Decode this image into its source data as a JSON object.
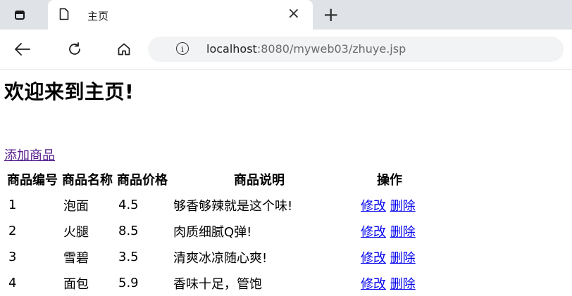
{
  "browser": {
    "tab_title": "主页",
    "close_glyph": "×",
    "new_tab_glyph": "+",
    "url_host": "localhost",
    "url_rest": ":8080/myweb03/zhuye.jsp"
  },
  "page": {
    "heading": "欢迎来到主页!",
    "add_link": "添加商品"
  },
  "table": {
    "headers": [
      "商品编号",
      "商品名称",
      "商品价格",
      "商品说明",
      "操作"
    ],
    "rows": [
      {
        "id": "1",
        "name": "泡面",
        "price": "4.5",
        "desc": "够香够辣就是这个味!",
        "edit": "修改",
        "delete": "删除"
      },
      {
        "id": "2",
        "name": "火腿",
        "price": "8.5",
        "desc": "肉质细腻Q弹!",
        "edit": "修改",
        "delete": "删除"
      },
      {
        "id": "3",
        "name": "雪碧",
        "price": "3.5",
        "desc": "清爽冰凉随心爽!",
        "edit": "修改",
        "delete": "删除"
      },
      {
        "id": "4",
        "name": "面包",
        "price": "5.9",
        "desc": "香味十足，管饱",
        "edit": "修改",
        "delete": "删除"
      }
    ]
  },
  "icons": {
    "tab_actions": "tab-actions-icon",
    "page": "page-icon",
    "close": "close-icon",
    "new_tab": "plus-icon",
    "back": "back-arrow-icon",
    "reload": "reload-icon",
    "home": "home-icon",
    "info": "info-icon"
  }
}
